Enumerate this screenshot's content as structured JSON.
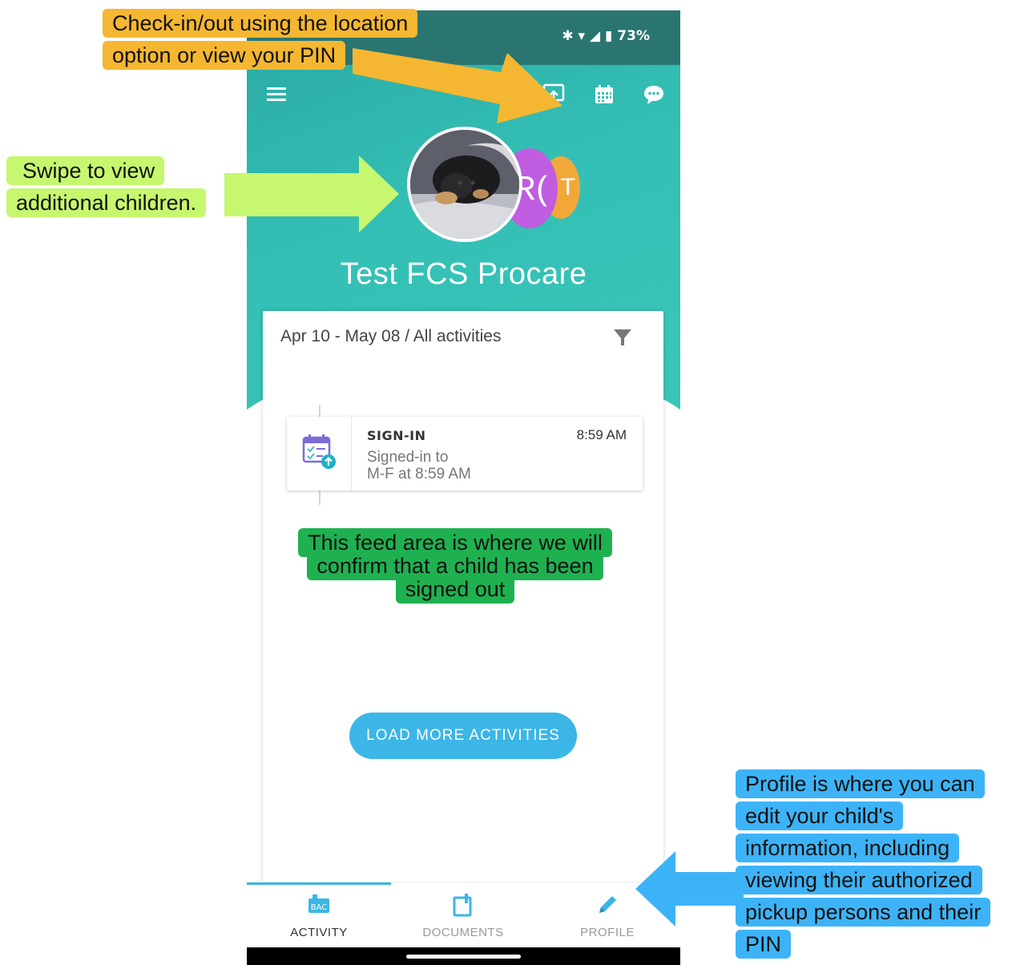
{
  "status_bar": {
    "battery": "73%"
  },
  "app": {
    "child_name": "Test FCS Procare"
  },
  "avatars": [
    {
      "kind": "photo",
      "initials": ""
    },
    {
      "kind": "initials",
      "initials": "R("
    },
    {
      "kind": "initials",
      "initials": "T"
    }
  ],
  "feed": {
    "filter_label": "Apr 10 - May 08 / All activities",
    "activities": [
      {
        "title": "SIGN-IN",
        "time": "8:59 AM",
        "line1": "Signed-in to",
        "line2": "M-F at 8:59 AM"
      }
    ],
    "load_more_label": "LOAD MORE ACTIVITIES"
  },
  "bottom_nav": {
    "tabs": [
      {
        "label": "ACTIVITY",
        "active": true
      },
      {
        "label": "DOCUMENTS",
        "active": false
      },
      {
        "label": "PROFILE",
        "active": false
      }
    ]
  },
  "annotations": {
    "checkin": {
      "line1": "Check-in/out using the location",
      "line2": "option or view your PIN"
    },
    "swipe": {
      "line1": "Swipe to view",
      "line2": "additional children."
    },
    "feed": {
      "line1": "This feed area is where we will",
      "line2": "confirm that a child has been",
      "line3": "signed out"
    },
    "profile": {
      "line1": "Profile is where you can",
      "line2": "edit your child's",
      "line3": "information, including",
      "line4": "viewing their authorized",
      "line5": "pickup persons and their",
      "line6": "PIN"
    }
  },
  "colors": {
    "teal": "#33bfb5",
    "accent_blue": "#3bb6e6",
    "callout_yellow": "#f5b731",
    "callout_lime": "#c6f76f",
    "callout_green": "#1fb150",
    "callout_blue": "#3db3f7"
  }
}
